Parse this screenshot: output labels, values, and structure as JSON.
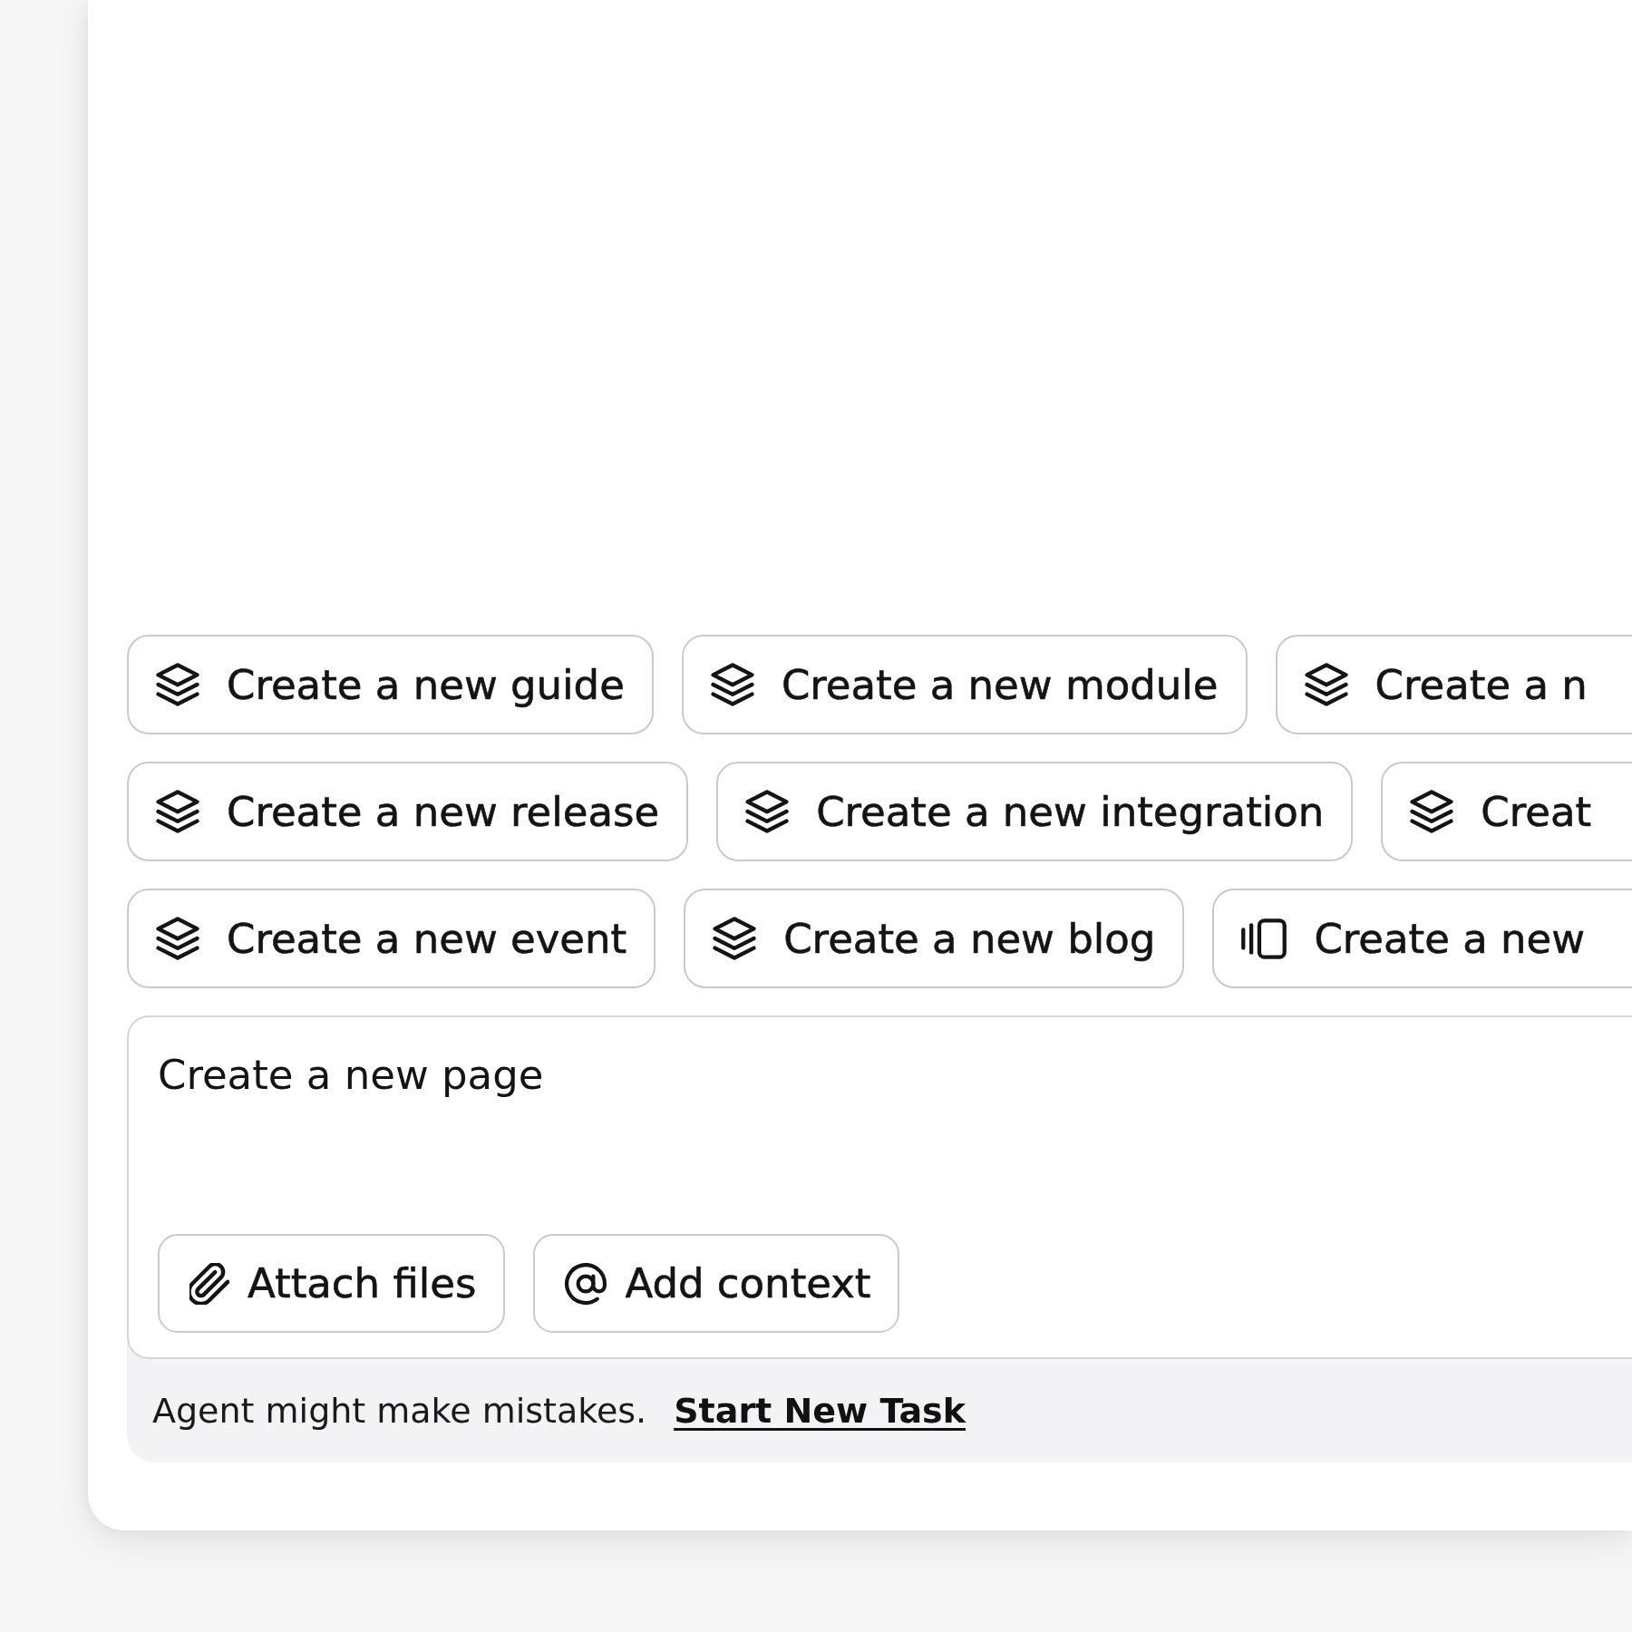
{
  "suggestions": [
    {
      "chips": [
        {
          "kind": "layers",
          "label": "Create a new guide"
        },
        {
          "kind": "layers",
          "label": "Create a new module"
        },
        {
          "kind": "layers",
          "label": "Create a n"
        }
      ]
    },
    {
      "chips": [
        {
          "kind": "layers",
          "label": "Create a new release"
        },
        {
          "kind": "layers",
          "label": "Create a new integration"
        },
        {
          "kind": "layers",
          "label": "Creat"
        }
      ]
    },
    {
      "chips": [
        {
          "kind": "layers",
          "label": "Create a new event"
        },
        {
          "kind": "layers",
          "label": "Create a new blog"
        },
        {
          "kind": "carousel",
          "label": "Create a new"
        }
      ]
    }
  ],
  "composer": {
    "value": "Create a new page",
    "actions": [
      {
        "kind": "attach",
        "label": "Attach files"
      },
      {
        "kind": "mention",
        "label": "Add context"
      }
    ]
  },
  "footer": {
    "note": "Agent might make mistakes.",
    "link": "Start New Task"
  }
}
